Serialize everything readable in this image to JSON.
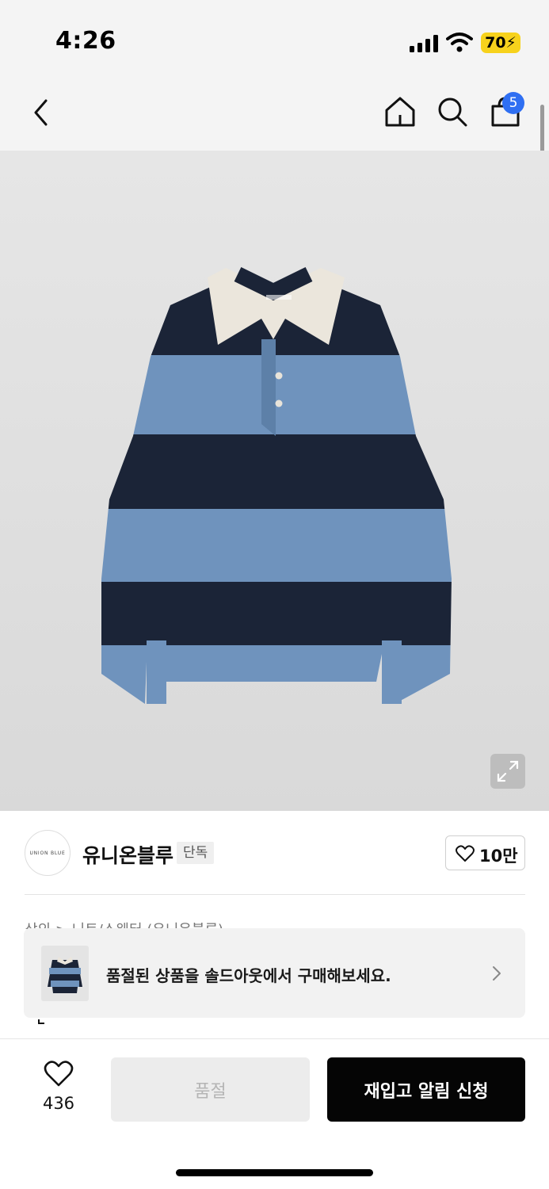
{
  "status_bar": {
    "time": "4:26",
    "battery": "70"
  },
  "nav": {
    "cart_count": "5"
  },
  "brand": {
    "logo_text": "UNION BLUE",
    "name": "유니온블루",
    "tag": "단독",
    "likes": "10만"
  },
  "breadcrumb_peek": "상의 > 니트/스웨터 (유니온블루)",
  "banner": {
    "text": "품절된 상품을 솔드아웃에서 구매해보세요."
  },
  "bottom_bar": {
    "wish_count": "436",
    "soldout_label": "품절",
    "restock_label": "재입고 알림 신청"
  },
  "colors": {
    "accent": "#2f6ff2",
    "navy_stripe": "#1b2437",
    "blue_stripe": "#6f93bd",
    "collar": "#ebe6dc",
    "battery": "#f7d21c"
  }
}
